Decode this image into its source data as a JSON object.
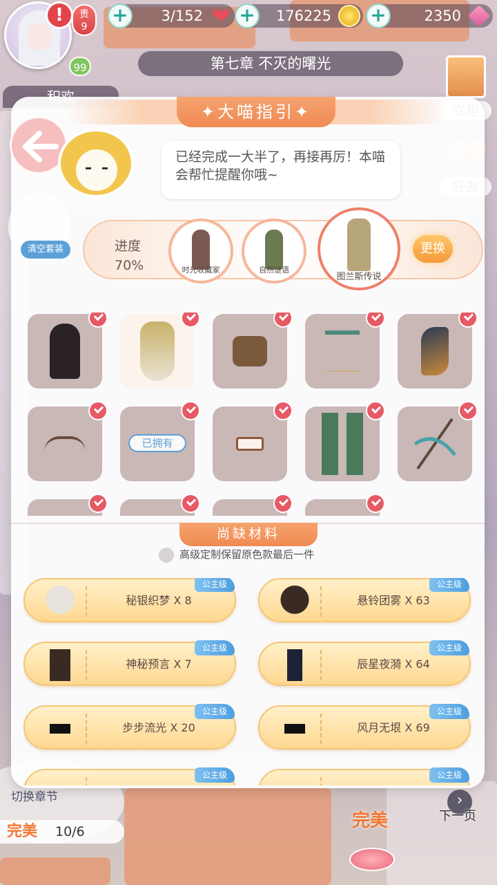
{
  "topbar": {
    "alert": "!",
    "vip_label": "贵",
    "vip_level": "9",
    "player_level": "99",
    "stamina": "3/152",
    "coins": "176225",
    "gems": "2350"
  },
  "chapter_title": "第七章 不灭的曙光",
  "side_tab": "积欢",
  "right_menu": {
    "wardrobe": "衣柜",
    "friends": "好友"
  },
  "panel": {
    "title": "✦大喵指引✦",
    "speech": "已经完成一大半了，再接再厉！本喵会帮忙提醒你哦~",
    "clear_suit": "清空套装",
    "progress_label": "进度",
    "progress_value": "70%",
    "suits": [
      "时光收藏家",
      "自然谜语",
      "图兰斯传说"
    ],
    "swap_button": "更换",
    "owned_label": "已拥有",
    "materials_title": "尚缺材料",
    "keep_option": "高级定制保留原色款最后一件",
    "materials": [
      {
        "name": "秘银织梦 X 8",
        "tag": "公主级"
      },
      {
        "name": "悬铃团雾 X 63",
        "tag": "公主级"
      },
      {
        "name": "神秘预言 X 7",
        "tag": "公主级"
      },
      {
        "name": "辰星夜漪 X 64",
        "tag": "公主级"
      },
      {
        "name": "步步流光 X 20",
        "tag": "公主级"
      },
      {
        "name": "风月无垠 X 69",
        "tag": "公主级"
      },
      {
        "name": "",
        "tag": "公主级"
      },
      {
        "name": "",
        "tag": "公主级"
      }
    ]
  },
  "bottom": {
    "switch_chapter": "切换章节",
    "perfect_label": "完美",
    "perfect_count": "10/6",
    "perfect_big": "完美",
    "next_page": "下一页",
    "next_arrow": "›"
  }
}
